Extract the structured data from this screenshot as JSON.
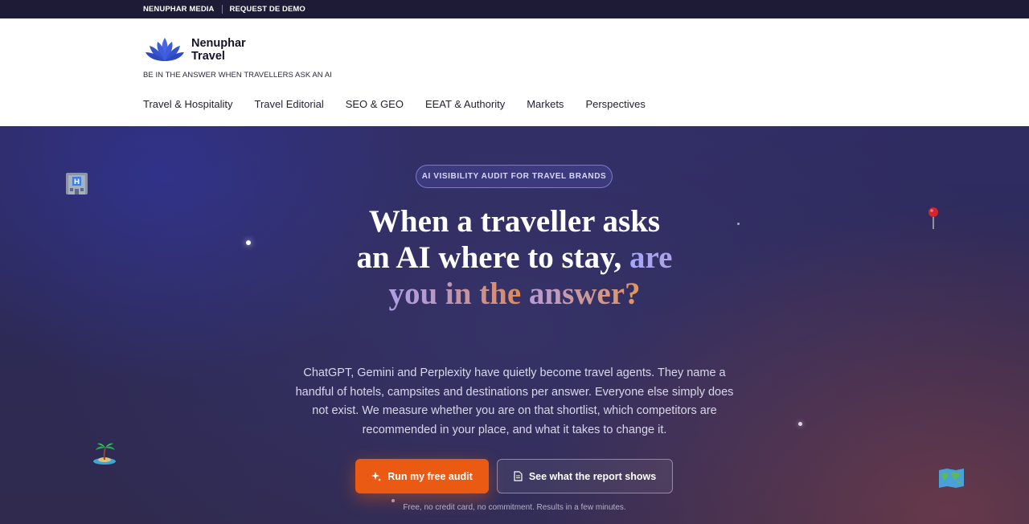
{
  "topbar": {
    "links": [
      "NENUPHAR MEDIA",
      "REQUEST DE DEMO"
    ]
  },
  "brand": {
    "name_line1": "Nenuphar",
    "name_line2": "Travel",
    "tagline": "BE IN THE ANSWER WHEN TRAVELLERS ASK AN AI"
  },
  "nav": {
    "items": [
      "Travel & Hospitality",
      "Travel Editorial",
      "SEO & GEO",
      "EEAT & Authority",
      "Markets",
      "Perspectives"
    ]
  },
  "hero": {
    "badge": "AI VISIBILITY AUDIT FOR TRAVEL BRANDS",
    "headline_plain": "When a traveller asks an AI where to stay,",
    "headline_accent": "are you in the",
    "headline_accent2": "answer?",
    "subtext": "ChatGPT, Gemini and Perplexity have quietly become travel agents. They name a handful of hotels, campsites and destinations per answer. Everyone else simply does not exist. We measure whether you are on that shortlist, which competitors are recommended in your place, and what it takes to change it.",
    "primary_cta": "Run my free audit",
    "secondary_cta": "See what the report shows",
    "fineprint": "Free, no credit card, no commitment. Results in a few minutes."
  },
  "icons": {
    "logo": "lotus-logo-icon",
    "deco": [
      "hotel-icon",
      "map-pin-icon",
      "island-icon",
      "world-map-icon"
    ],
    "primary_cta": "sparkle-icon",
    "secondary_cta": "document-icon"
  },
  "colors": {
    "topbar": "#1e1b36",
    "accent_orange": "#ea5a12",
    "logo_blue": "#3a57d8",
    "badge_text": "#d7d8ff"
  }
}
